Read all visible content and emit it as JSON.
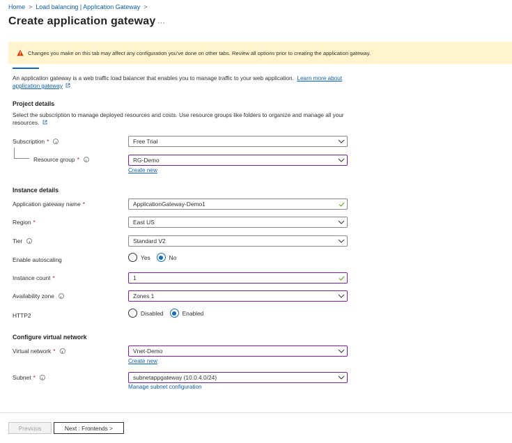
{
  "breadcrumb": {
    "items": [
      "Home",
      "Load balancing | Application Gateway"
    ]
  },
  "page": {
    "title": "Create application gateway",
    "more": "···"
  },
  "banner": {
    "text": "Changes you make on this tab may affect any configuration you've done on other tabs. Review all options prior to creating the application gateway."
  },
  "intro": {
    "text": "An application gateway is a web traffic load balancer that enables you to manage traffic to your web application.",
    "link": "Learn more about application gateway"
  },
  "project": {
    "heading": "Project details",
    "description": "Select the subscription to manage deployed resources and costs. Use resource groups like folders to organize and manage all your resources.",
    "subscription_label": "Subscription",
    "subscription_value": "Free Trial",
    "resource_group_label": "Resource group",
    "resource_group_value": "RG-Demo",
    "create_new": "Create new"
  },
  "instance": {
    "heading": "Instance details",
    "name_label": "Application gateway name",
    "name_value": "ApplicationGateway-Demo1",
    "region_label": "Region",
    "region_value": "East US",
    "tier_label": "Tier",
    "tier_value": "Standard V2",
    "autoscaling_label": "Enable autoscaling",
    "autoscaling_yes": "Yes",
    "autoscaling_no": "No",
    "instance_count_label": "Instance count",
    "instance_count_value": "1",
    "availability_label": "Availability zone",
    "availability_value": "Zones 1",
    "http2_label": "HTTP2",
    "http2_disabled": "Disabled",
    "http2_enabled": "Enabled"
  },
  "network": {
    "heading": "Configure virtual network",
    "vnet_label": "Virtual network",
    "vnet_value": "Vnet-Demo",
    "create_new": "Create new",
    "subnet_label": "Subnet",
    "subnet_value": "subnetappgateway (10.0.4.0/24)",
    "manage_subnet": "Manage subnet configuration"
  },
  "footer": {
    "previous": "Previous",
    "next": "Next : Frontends >"
  },
  "colors": {
    "accent": "#0f6cbd",
    "focus_border": "#7a1fa2",
    "required": "#a4262c",
    "warning_bg": "#fff4ce",
    "valid_check": "#57a300"
  }
}
